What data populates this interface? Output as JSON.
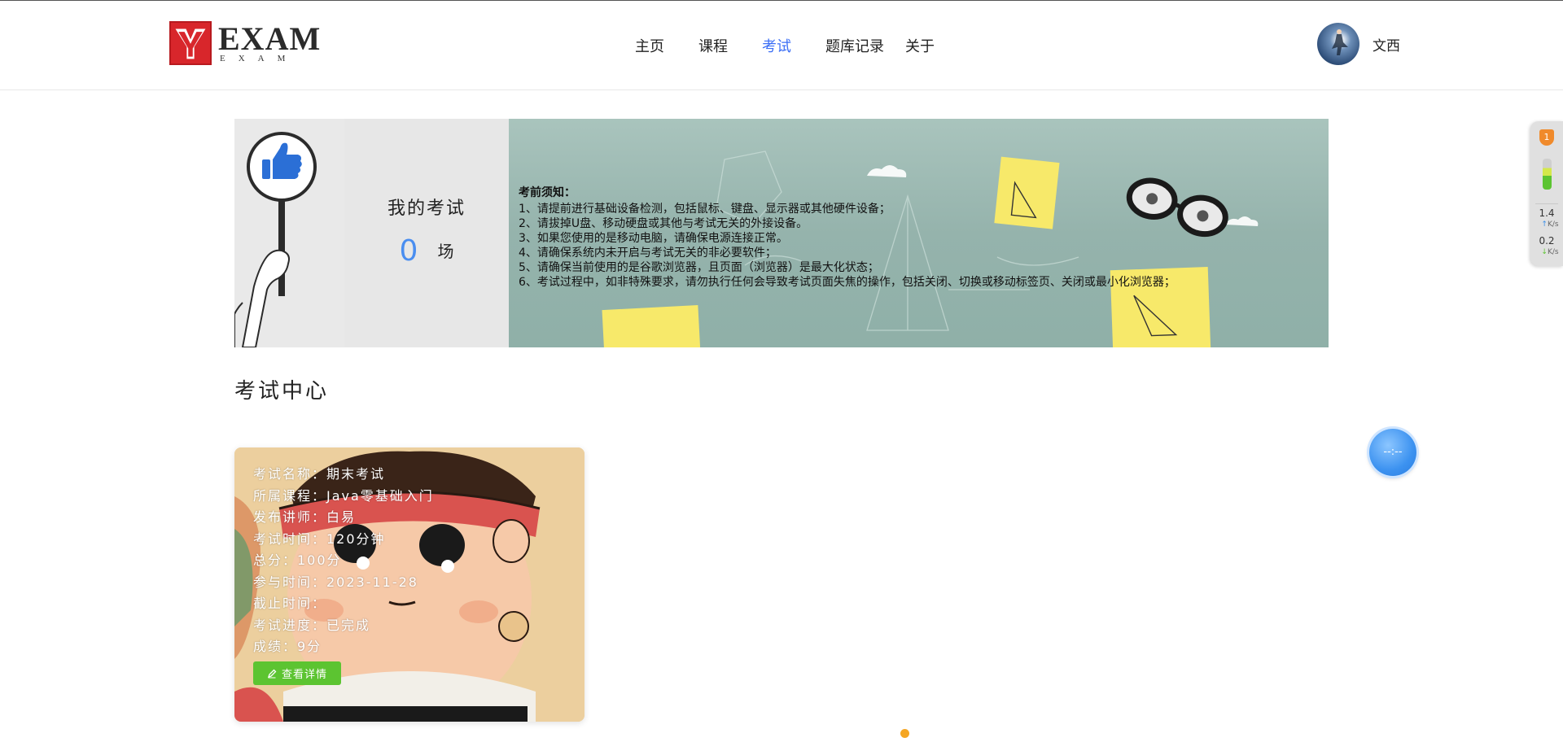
{
  "header": {
    "logo_text": "EXAM",
    "logo_sub": "EXAM",
    "nav": [
      {
        "label": "主页"
      },
      {
        "label": "课程"
      },
      {
        "label": "考试"
      },
      {
        "label": "题库记录"
      },
      {
        "label": "关于"
      }
    ],
    "active_nav": "考试",
    "username": "文西"
  },
  "banner": {
    "my_exams_title": "我的考试",
    "exam_count": "0",
    "exam_count_unit": "场",
    "notice_title": "考前须知：",
    "notices": [
      "1、请提前进行基础设备检测，包括鼠标、键盘、显示器或其他硬件设备；",
      "2、请拔掉U盘、移动硬盘或其他与考试无关的外接设备。",
      "3、如果您使用的是移动电脑，请确保电源连接正常。",
      "4、请确保系统内未开启与考试无关的非必要软件；",
      "5、请确保当前使用的是谷歌浏览器，且页面（浏览器）是最大化状态；",
      "6、考试过程中，如非特殊要求，请勿执行任何会导致考试页面失焦的操作，包括关闭、切换或移动标签页、关闭或最小化浏览器；"
    ]
  },
  "section": {
    "title": "考试中心"
  },
  "exam_card": {
    "lines": [
      "考试名称：期末考试",
      "所属课程：Java零基础入门",
      "发布讲师：白易",
      "考试时间：120分钟",
      "总分：100分",
      "参与时间：2023-11-28",
      "截止时间：",
      "考试进度：已完成",
      "成绩：9分"
    ],
    "button_label": "查看详情",
    "button_color": "#5cc431"
  },
  "side_widget": {
    "badge": "1",
    "upload_speed": "1.4",
    "upload_unit": "K/s",
    "download_speed": "0.2",
    "download_unit": "K/s"
  },
  "float_button": {
    "text": "--:--"
  },
  "colors": {
    "accent": "#3b6ef5",
    "count_color": "#4a8ef0",
    "pager_dot": "#f5a623"
  }
}
